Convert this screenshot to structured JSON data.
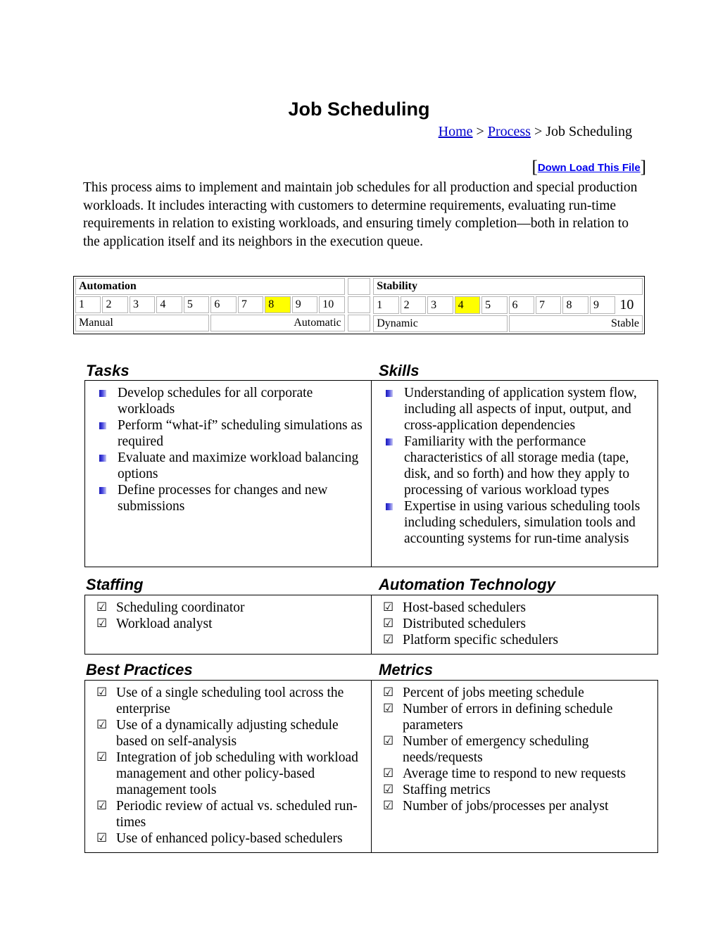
{
  "header": {
    "title": "Job Scheduling",
    "breadcrumb": {
      "home": "Home",
      "sep1": "> ",
      "process": "Process",
      "sep2": "> ",
      "current": "Job Scheduling"
    },
    "download": {
      "bracket_open": "[",
      "label": "Down Load This File",
      "bracket_close": "]"
    }
  },
  "intro": "This process aims to implement and maintain job schedules for all production and special production workloads. It includes interacting with customers to determine requirements, evaluating run-time requirements in relation to existing workloads, and ensuring timely completion—both in relation to the application itself and its neighbors in the execution queue.",
  "scales": {
    "automation": {
      "heading": "Automation",
      "numbers": [
        "1",
        "2",
        "3",
        "4",
        "5",
        "6",
        "7",
        "8",
        "9",
        "10"
      ],
      "selected": "8",
      "left_label": "Manual",
      "right_label": "Automatic"
    },
    "stability": {
      "heading": "Stability",
      "numbers": [
        "1",
        "2",
        "3",
        "4",
        "5",
        "6",
        "7",
        "8",
        "9",
        "10"
      ],
      "selected": "4",
      "left_label": "Dynamic",
      "right_label": "Stable"
    }
  },
  "sections": {
    "tasks": {
      "heading": "Tasks",
      "items": [
        "Develop schedules for all corporate workloads",
        "Perform “what-if” scheduling simulations as required",
        "Evaluate and maximize workload balancing options",
        "Define processes for changes and new submissions"
      ]
    },
    "skills": {
      "heading": "Skills",
      "items": [
        "Understanding of application system flow, including all aspects of input, output, and cross-application dependencies",
        "Familiarity with the performance characteristics of all storage media (tape, disk, and so forth) and how they apply to processing of various workload types",
        "Expertise in using various scheduling tools including schedulers, simulation tools and accounting systems for run-time analysis"
      ]
    },
    "staffing": {
      "heading": "Staffing",
      "items": [
        "Scheduling coordinator",
        "Workload analyst"
      ]
    },
    "automation_technology": {
      "heading": "Automation Technology",
      "items": [
        "Host-based schedulers",
        "Distributed schedulers",
        "Platform specific schedulers"
      ]
    },
    "best_practices": {
      "heading": "Best Practices",
      "items": [
        "Use of a single scheduling tool across the enterprise",
        "Use of a dynamically adjusting schedule based on self-analysis",
        "Integration of job scheduling with workload management and other policy-based management tools",
        "Periodic review of actual vs. scheduled run-times",
        "Use of enhanced policy-based schedulers"
      ]
    },
    "metrics": {
      "heading": "Metrics",
      "items": [
        "Percent of jobs meeting schedule",
        "Number of errors in defining schedule parameters",
        "Number of emergency scheduling needs/requests",
        "Average time to respond to new requests",
        "Staffing metrics",
        "Number of jobs/processes per analyst"
      ]
    }
  },
  "colors": {
    "highlight": "#ffff00",
    "link": "#0000ee",
    "breadcrumb_link": "#0000cc",
    "bullet": "#1a1ab8"
  }
}
